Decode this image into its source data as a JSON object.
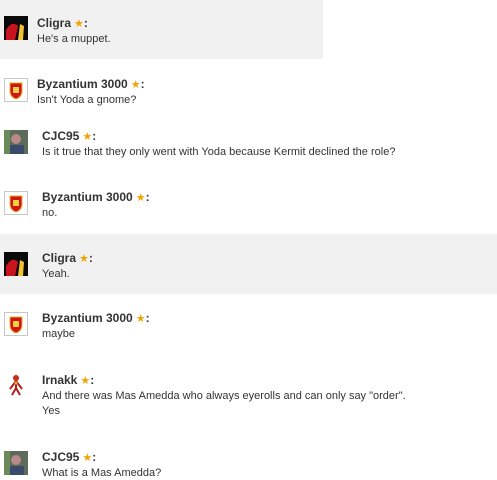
{
  "colors": {
    "highlight": "#f1f1f1",
    "star": "#f0a400"
  },
  "messages": [
    {
      "author": "Cligra",
      "star": "★",
      "colon": ":",
      "text": [
        "He's a muppet."
      ],
      "avatar": "cligra-avatar"
    },
    {
      "author": "Byzantium 3000",
      "star": "★",
      "colon": ":",
      "text": [
        "Isn't Yoda a gnome?"
      ],
      "avatar": "byzantium-avatar"
    },
    {
      "author": "CJC95",
      "star": "★",
      "colon": ":",
      "text": [
        "Is it true that they only went with Yoda because Kermit declined the role?"
      ],
      "avatar": "cjc95-avatar"
    },
    {
      "author": "Byzantium 3000",
      "star": "★",
      "colon": ":",
      "text": [
        "no."
      ],
      "avatar": "byzantium-avatar"
    },
    {
      "author": "Cligra",
      "star": "★",
      "colon": ":",
      "text": [
        "Yeah."
      ],
      "avatar": "cligra-avatar"
    },
    {
      "author": "Byzantium 3000",
      "star": "★",
      "colon": ":",
      "text": [
        "maybe"
      ],
      "avatar": "byzantium-avatar"
    },
    {
      "author": "Irnakk",
      "star": "★",
      "colon": ":",
      "text": [
        "And there was Mas Amedda who always eyerolls and can only say \"order\".",
        "Yes"
      ],
      "avatar": "irnakk-avatar"
    },
    {
      "author": "CJC95",
      "star": "★",
      "colon": ":",
      "text": [
        "What is a Mas Amedda?"
      ],
      "avatar": "cjc95-avatar"
    }
  ]
}
